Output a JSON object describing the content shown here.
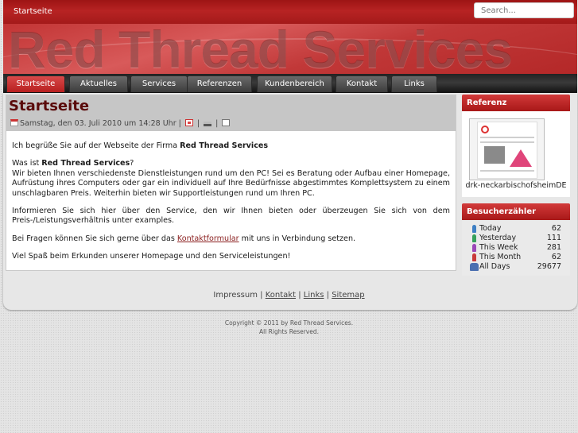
{
  "header": {
    "breadcrumb": "Startseite",
    "site_title": "Red Thread Services",
    "search": {
      "placeholder": "Search..."
    }
  },
  "nav": {
    "items": [
      "Startseite",
      "Aktuelles",
      "Services",
      "Referenzen",
      "Kundenbereich",
      "Kontakt",
      "Links"
    ],
    "active_index": 0
  },
  "article": {
    "title": "Startseite",
    "date": "Samstag, den 03. Juli 2010 um 14:28 Uhr",
    "separator": "|",
    "greeting_prefix": "Ich begrüße Sie auf der Webseite der Firma ",
    "company": "Red Thread Services",
    "question_prefix": "Was ist ",
    "question_suffix": "?",
    "para2": "Wir bieten Ihnen verschiedenste Dienstleistungen rund um den PC! Sei es Beratung oder Aufbau einer Homepage, Aufrüstung ihres Computers oder gar ein individuell auf Ihre Bedürfnisse abgestimmtes Komplettsystem zu einem unschlagbaren Preis. Weiterhin bieten wir Supportleistungen rund um Ihren PC.",
    "para3": "Informieren Sie sich hier über den Service, den wir Ihnen bieten oder überzeugen Sie sich von dem Preis-/Leistungsverhältnis unter examples.",
    "para4_prefix": "Bei Fragen können Sie sich gerne über das ",
    "para4_link": "Kontaktformular",
    "para4_suffix": " mit uns in Verbindung setzen.",
    "para5": "Viel Spaß beim Erkunden unserer Homepage und den Serviceleistungen!"
  },
  "sidebar": {
    "referenz": {
      "title": "Referenz",
      "caption": "drk-neckarbischofsheimDE"
    },
    "counter": {
      "title": "Besucherzähler",
      "rows": [
        {
          "label": "Today",
          "value": "62",
          "icon": "person-blue-icon",
          "color": "#3d7fc4"
        },
        {
          "label": "Yesterday",
          "value": "111",
          "icon": "person-green-icon",
          "color": "#36a05a"
        },
        {
          "label": "This Week",
          "value": "281",
          "icon": "person-purple-icon",
          "color": "#9b47b8"
        },
        {
          "label": "This Month",
          "value": "62",
          "icon": "person-red-icon",
          "color": "#c93a3a"
        },
        {
          "label": "All Days",
          "value": "29677",
          "icon": "people-group-icon",
          "color": "#4a6fb0"
        }
      ]
    }
  },
  "footer": {
    "impressum": "Impressum",
    "links": [
      "Kontakt",
      "Links",
      "Sitemap"
    ],
    "separator": "|",
    "copyright_line1": "Copyright © 2011 by Red Thread Services.",
    "copyright_line2": "All Rights Reserved."
  },
  "colors": {
    "accent": "#b71f1f",
    "title": "#5a0a0a",
    "link": "#8a1e1e"
  }
}
